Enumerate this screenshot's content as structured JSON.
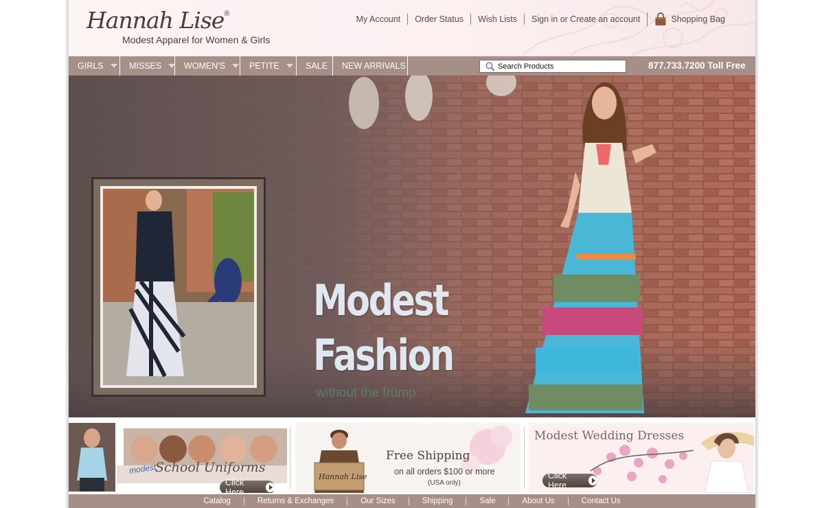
{
  "brand": {
    "logo_text": "Hannah Lise",
    "registered": "®",
    "tagline": "Modest Apparel for Women & Girls",
    "accent_color": "#a58f86",
    "header_bg": "#fcf0f1"
  },
  "top_links": {
    "my_account": "My Account",
    "order_status": "Order Status",
    "wish_lists": "Wish Lists",
    "sign_in": "Sign in or Create an account",
    "shopping_bag": "Shopping Bag",
    "bag_icon": "shopping-bag-icon"
  },
  "nav": {
    "items": [
      {
        "label": "GIRLS",
        "dropdown": true
      },
      {
        "label": "MISSES",
        "dropdown": true
      },
      {
        "label": "WOMEN'S",
        "dropdown": true
      },
      {
        "label": "PETITE",
        "dropdown": true
      },
      {
        "label": "SALE",
        "dropdown": false
      },
      {
        "label": "NEW ARRIVALS",
        "dropdown": false
      }
    ],
    "search_placeholder": "Search Products",
    "search_icon": "magnifier-icon",
    "phone": "877.733.7200 Toll Free"
  },
  "hero": {
    "headline_line1": "Modest",
    "headline_line2": "Fashion",
    "tagline": "without the frump"
  },
  "promos": {
    "uniforms": {
      "title_small": "modest",
      "title": "School Uniforms",
      "button": "Click Here"
    },
    "shipping": {
      "title": "Free Shipping",
      "line1": "on all orders $100 or more",
      "line2": "(USA only)",
      "box_logo": "Hannah Lise"
    },
    "wedding": {
      "title": "Modest Wedding Dresses",
      "button": "Click Here"
    }
  },
  "footer": {
    "links": [
      "Catalog",
      "Returns & Exchanges",
      "Our Sizes",
      "Shipping",
      "Sale",
      "About Us",
      "Contact Us"
    ]
  }
}
